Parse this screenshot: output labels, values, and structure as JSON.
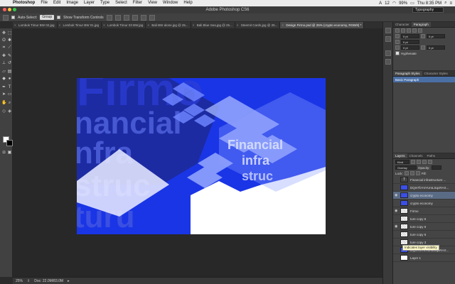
{
  "menubar": {
    "apple_icon": "apple-icon",
    "items": [
      "Photoshop",
      "File",
      "Edit",
      "Image",
      "Layer",
      "Type",
      "Select",
      "Filter",
      "View",
      "Window",
      "Help"
    ],
    "status_right": {
      "user": "12",
      "battery": "99%",
      "clock": "Thu 8:35 PM"
    }
  },
  "titlebar": {
    "title": "Adobe Photoshop CS6",
    "workspace": "Typography"
  },
  "optionsbar": {
    "auto_select_label": "Auto-Select:",
    "auto_select_value": "Group",
    "transform_label": "Show Transform Controls"
  },
  "tabs": [
    {
      "label": "Lombok Timur BW 02.jpg",
      "active": false
    },
    {
      "label": "Lombok Timur BW 01.jpg",
      "active": false
    },
    {
      "label": "Lombok Timur 03 BW.jpg",
      "active": false
    },
    {
      "label": "Bali BW alone.jpg @ 25...",
      "active": false
    },
    {
      "label": "Bali Blue Sea.jpg @ 25...",
      "active": false
    },
    {
      "label": "Steemit Cards.jpg @ 25...",
      "active": false
    },
    {
      "label": "Design Firmo.psd @ 25% (crypto economy, RGB/8) *",
      "active": true
    }
  ],
  "canvas_text": {
    "firmo": "Firmo",
    "financial_big": "nancial",
    "infra_big": "nfra",
    "struc_big": "struc",
    "turu_big": "turu",
    "financial_small": "Financial",
    "infra_small": "infra",
    "struc_small": "struc"
  },
  "statusbar": {
    "zoom": "25%",
    "doc": "Doc: 22.0M/83.0M"
  },
  "character_panel": {
    "tabs": [
      "Character",
      "Paragraph"
    ],
    "active_tab": "Paragraph",
    "fields": [
      "0 pt",
      "0 pt",
      "0 pt",
      "0 pt",
      "0 pt"
    ],
    "hyphenate_label": "Hyphenate"
  },
  "paragraph_styles_panel": {
    "tabs": [
      "Paragraph Styles",
      "Character Styles"
    ],
    "items": [
      "Basic Paragraph"
    ]
  },
  "layers_panel": {
    "tabs": [
      "Layers",
      "Channels",
      "Paths"
    ],
    "kind_label": "Kind",
    "blend_mode": "Overlay",
    "opacity_label": "Opacity:",
    "lock_label": "Lock:",
    "fill_label": "Fill:",
    "layers": [
      {
        "name": "Financial infrastructure ...",
        "thumb": "text",
        "selected": false,
        "visible": false
      },
      {
        "name": "DQmTbYsYUmLSqcRAX...",
        "thumb": "image",
        "selected": false,
        "visible": false
      },
      {
        "name": "crypto economy",
        "thumb": "image",
        "selected": true,
        "visible": true
      },
      {
        "name": "crypto economy",
        "thumb": "image",
        "selected": false,
        "visible": false
      },
      {
        "name": "Firmo",
        "thumb": "checker",
        "selected": false,
        "visible": true
      },
      {
        "name": "ture copy 6",
        "thumb": "checker",
        "selected": false,
        "visible": false
      },
      {
        "name": "ture copy 6",
        "thumb": "checker",
        "selected": false,
        "visible": true
      },
      {
        "name": "ture copy 6",
        "thumb": "checker",
        "selected": false,
        "visible": false
      },
      {
        "name": "ture copy 3",
        "thumb": "checker",
        "selected": false,
        "visible": false
      },
      {
        "name": "DQmTbYsYUmLSqcRAX...",
        "thumb": "image",
        "selected": false,
        "visible": false
      },
      {
        "name": "Layer 1",
        "thumb": "white",
        "selected": false,
        "visible": false
      }
    ],
    "tooltip": "Indicates layer visibility"
  }
}
